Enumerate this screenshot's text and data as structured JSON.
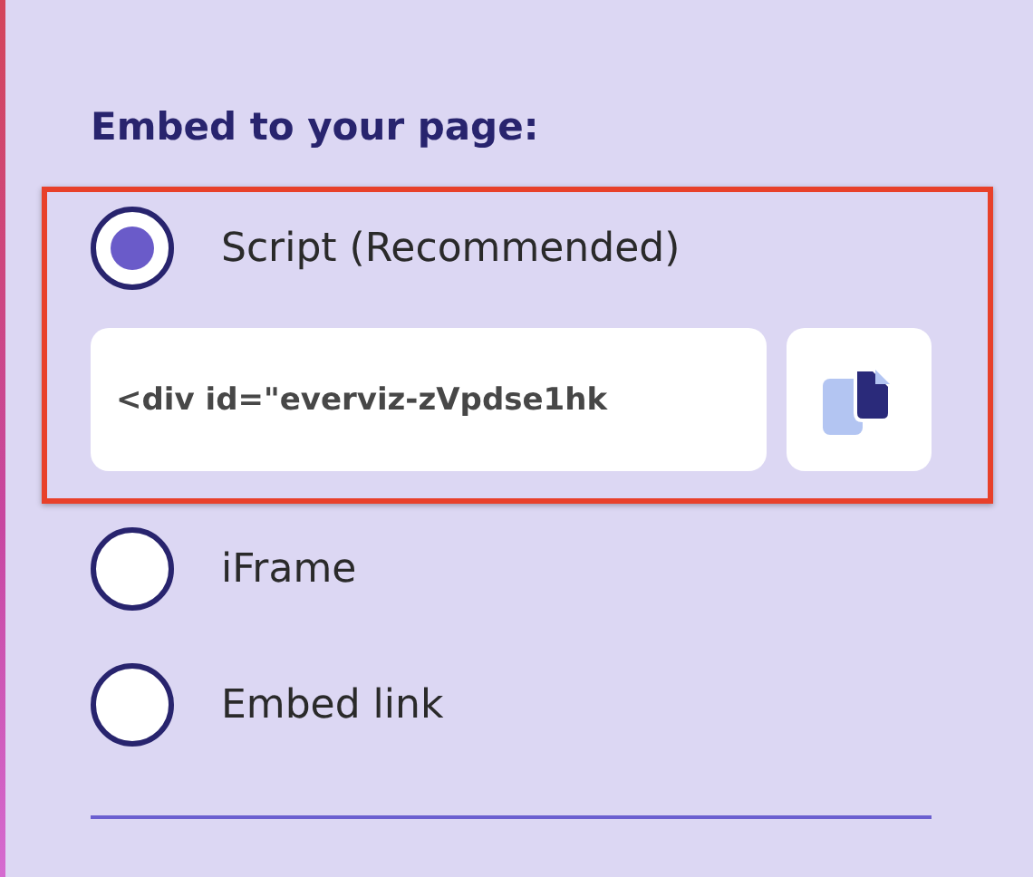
{
  "heading": "Embed to your page:",
  "options": [
    {
      "label": "Script (Recommended)",
      "selected": true,
      "highlighted": true,
      "code": "<div id=\"everviz-zVpdse1hk"
    },
    {
      "label": "iFrame",
      "selected": false,
      "highlighted": false
    },
    {
      "label": "Embed link",
      "selected": false,
      "highlighted": false
    }
  ]
}
